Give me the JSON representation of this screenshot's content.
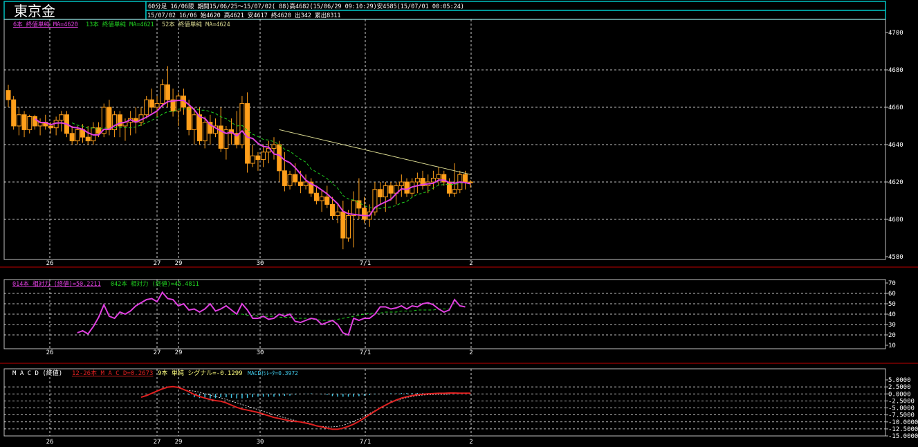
{
  "header": {
    "title": "東京金",
    "period_line": "60分足 16/06限  期間15/06/25～15/07/02( 88)高4682(15/06/29 09:10:29)安4585(15/07/01 00:05:24)",
    "ohlc_line": "15/07/02 16/06 始4620 高4621 安4617 終4620 出342 累出8311"
  },
  "legends": {
    "ma6": "6本 終値単純 MA=4620",
    "ma13": "13本 終値単純 MA=4621",
    "ma52": "52本 終値単純 MA=4624",
    "rsi14": "014本 相対力 (終値)=50.2211",
    "rsi42": "042本 相対力 (終値)=45.4811",
    "macd_title": "M A C D (終値)",
    "macd": "12-26本 M A C D=0.2673",
    "signal": "9本 単純 シグナル=-0.1299",
    "osc": "MACDｵｼﾚｰﾀ=0.3972"
  },
  "colors": {
    "bg": "#000000",
    "frame": "#c0c0c0",
    "header_border": "#00c0c0",
    "candle": "#ff9f1a",
    "ma6": "#e040e0",
    "ma13": "#20d020",
    "ma52": "#d8d890",
    "rsi14": "#e040e0",
    "rsi42": "#20d020",
    "macd": "#e02020",
    "signal": "#ffffff",
    "osc": "#40c8e8",
    "separator": "#c00000",
    "grid": "#ffffff"
  },
  "chart_data": [
    {
      "type": "candlestick",
      "panel": "price",
      "ylim": [
        4580,
        4700
      ],
      "yticks": [
        4580,
        4600,
        4620,
        4640,
        4660,
        4680,
        4700
      ],
      "x_labels": [
        "26",
        "27",
        "29",
        "30",
        "7/1",
        "2"
      ],
      "bars": [
        [
          4669,
          4672,
          4660,
          4664
        ],
        [
          4664,
          4666,
          4648,
          4650
        ],
        [
          4650,
          4660,
          4645,
          4656
        ],
        [
          4656,
          4658,
          4644,
          4648
        ],
        [
          4648,
          4656,
          4646,
          4655
        ],
        [
          4655,
          4656,
          4648,
          4650
        ],
        [
          4650,
          4654,
          4645,
          4652
        ],
        [
          4652,
          4656,
          4648,
          4650
        ],
        [
          4650,
          4652,
          4646,
          4649
        ],
        [
          4649,
          4655,
          4645,
          4653
        ],
        [
          4653,
          4658,
          4647,
          4656
        ],
        [
          4656,
          4658,
          4644,
          4646
        ],
        [
          4646,
          4650,
          4640,
          4642
        ],
        [
          4642,
          4650,
          4640,
          4648
        ],
        [
          4648,
          4651,
          4641,
          4644
        ],
        [
          4644,
          4650,
          4640,
          4642
        ],
        [
          4642,
          4652,
          4640,
          4649
        ],
        [
          4649,
          4652,
          4644,
          4646
        ],
        [
          4646,
          4662,
          4644,
          4660
        ],
        [
          4660,
          4664,
          4645,
          4648
        ],
        [
          4648,
          4658,
          4644,
          4656
        ],
        [
          4656,
          4658,
          4644,
          4650
        ],
        [
          4650,
          4654,
          4642,
          4652
        ],
        [
          4652,
          4658,
          4645,
          4654
        ],
        [
          4654,
          4660,
          4646,
          4652
        ],
        [
          4652,
          4660,
          4650,
          4656
        ],
        [
          4656,
          4666,
          4654,
          4664
        ],
        [
          4664,
          4670,
          4657,
          4660
        ],
        [
          4660,
          4666,
          4655,
          4662
        ],
        [
          4662,
          4675,
          4660,
          4672
        ],
        [
          4672,
          4682,
          4660,
          4664
        ],
        [
          4664,
          4670,
          4655,
          4658
        ],
        [
          4658,
          4668,
          4650,
          4666
        ],
        [
          4666,
          4670,
          4656,
          4660
        ],
        [
          4660,
          4664,
          4645,
          4648
        ],
        [
          4648,
          4660,
          4640,
          4656
        ],
        [
          4656,
          4660,
          4640,
          4642
        ],
        [
          4642,
          4655,
          4638,
          4652
        ],
        [
          4652,
          4656,
          4640,
          4646
        ],
        [
          4646,
          4654,
          4644,
          4650
        ],
        [
          4650,
          4660,
          4636,
          4638
        ],
        [
          4638,
          4650,
          4632,
          4648
        ],
        [
          4648,
          4654,
          4640,
          4646
        ],
        [
          4646,
          4658,
          4638,
          4640
        ],
        [
          4640,
          4666,
          4638,
          4662
        ],
        [
          4662,
          4668,
          4625,
          4630
        ],
        [
          4630,
          4640,
          4628,
          4634
        ],
        [
          4634,
          4636,
          4626,
          4632
        ],
        [
          4632,
          4640,
          4628,
          4636
        ],
        [
          4636,
          4642,
          4630,
          4638
        ],
        [
          4638,
          4644,
          4632,
          4640
        ],
        [
          4640,
          4642,
          4620,
          4626
        ],
        [
          4626,
          4636,
          4615,
          4618
        ],
        [
          4618,
          4626,
          4616,
          4624
        ],
        [
          4624,
          4630,
          4618,
          4620
        ],
        [
          4620,
          4626,
          4614,
          4618
        ],
        [
          4618,
          4624,
          4616,
          4620
        ],
        [
          4620,
          4622,
          4612,
          4614
        ],
        [
          4614,
          4618,
          4608,
          4610
        ],
        [
          4610,
          4616,
          4604,
          4612
        ],
        [
          4612,
          4618,
          4606,
          4608
        ],
        [
          4608,
          4612,
          4600,
          4602
        ],
        [
          4602,
          4608,
          4598,
          4604
        ],
        [
          4604,
          4610,
          4584,
          4590
        ],
        [
          4590,
          4605,
          4588,
          4602
        ],
        [
          4602,
          4615,
          4585,
          4610
        ],
        [
          4610,
          4622,
          4600,
          4606
        ],
        [
          4606,
          4612,
          4598,
          4600
        ],
        [
          4600,
          4608,
          4596,
          4604
        ],
        [
          4604,
          4620,
          4602,
          4616
        ],
        [
          4616,
          4620,
          4608,
          4612
        ],
        [
          4612,
          4620,
          4604,
          4618
        ],
        [
          4618,
          4620,
          4610,
          4614
        ],
        [
          4614,
          4620,
          4608,
          4618
        ],
        [
          4618,
          4624,
          4612,
          4620
        ],
        [
          4620,
          4622,
          4612,
          4614
        ],
        [
          4614,
          4622,
          4612,
          4620
        ],
        [
          4620,
          4625,
          4614,
          4622
        ],
        [
          4622,
          4626,
          4616,
          4618
        ],
        [
          4618,
          4624,
          4614,
          4620
        ],
        [
          4620,
          4626,
          4616,
          4622
        ],
        [
          4622,
          4628,
          4618,
          4624
        ],
        [
          4624,
          4626,
          4618,
          4620
        ],
        [
          4620,
          4622,
          4612,
          4614
        ],
        [
          4614,
          4630,
          4612,
          4616
        ],
        [
          4616,
          4626,
          4614,
          4624
        ],
        [
          4624,
          4626,
          4616,
          4620
        ],
        [
          4620,
          4621,
          4617,
          4620
        ]
      ],
      "ma52_start_index": 51
    },
    {
      "type": "line",
      "panel": "rsi",
      "ylim": [
        10,
        70
      ],
      "yticks": [
        10,
        20,
        30,
        40,
        50,
        60,
        70
      ],
      "rsi14": [
        null,
        null,
        null,
        null,
        null,
        null,
        null,
        null,
        null,
        null,
        null,
        null,
        null,
        22,
        24,
        21,
        28,
        37,
        49,
        38,
        36,
        42,
        40,
        43,
        48,
        51,
        54,
        55,
        52,
        61,
        55,
        54,
        48,
        50,
        44,
        45,
        42,
        45,
        50,
        43,
        45,
        48,
        44,
        40,
        50,
        44,
        36,
        36,
        38,
        35,
        36,
        40,
        38,
        40,
        33,
        32,
        34,
        36,
        35,
        30,
        32,
        34,
        30,
        22,
        20,
        36,
        34,
        36,
        36,
        40,
        47,
        47,
        45,
        46,
        48,
        45,
        48,
        47,
        50,
        51,
        49,
        45,
        42,
        44,
        54,
        48,
        47
      ],
      "rsi42": [
        null,
        null,
        null,
        null,
        null,
        null,
        null,
        null,
        null,
        null,
        null,
        null,
        null,
        null,
        null,
        null,
        null,
        null,
        null,
        null,
        null,
        null,
        null,
        null,
        null,
        null,
        null,
        null,
        null,
        null,
        null,
        null,
        null,
        null,
        null,
        null,
        null,
        null,
        null,
        null,
        null,
        null,
        40,
        40,
        40,
        39,
        39,
        38,
        38,
        38,
        38,
        37,
        37,
        37,
        36,
        36,
        36,
        35,
        35,
        34,
        34,
        34,
        35,
        36,
        37,
        38,
        39,
        40,
        41,
        41,
        41,
        42,
        42,
        42,
        43,
        43,
        43,
        44,
        44,
        44,
        44,
        45,
        45,
        45
      ]
    },
    {
      "type": "line",
      "panel": "macd",
      "ylim": [
        -15,
        5
      ],
      "yticks": [
        -15,
        -12.5,
        -10,
        -7.5,
        -5,
        -2.5,
        0,
        2.5,
        5
      ],
      "ytick_labels": [
        "-15.0000",
        "-12.5000",
        "-10.0000",
        "-7.5000",
        "-5.0000",
        "-2.5000",
        "0.0000",
        "2.5000",
        "5.0000"
      ],
      "macd": [
        null,
        null,
        null,
        null,
        null,
        null,
        null,
        null,
        null,
        null,
        null,
        null,
        null,
        null,
        null,
        null,
        null,
        null,
        null,
        null,
        null,
        null,
        null,
        null,
        null,
        -1.2,
        -0.6,
        0.2,
        1.0,
        1.8,
        2.4,
        2.6,
        2.3,
        1.6,
        0.8,
        -0.2,
        -0.9,
        -1.5,
        -2.0,
        -2.4,
        -2.6,
        -3.2,
        -4.0,
        -4.8,
        -5.4,
        -5.8,
        -6.2,
        -6.6,
        -7.2,
        -7.8,
        -8.4,
        -8.8,
        -9.2,
        -9.6,
        -9.8,
        -10.0,
        -10.4,
        -10.8,
        -11.4,
        -11.8,
        -12.2,
        -12.6,
        -12.6,
        -12.2,
        -11.6,
        -10.8,
        -9.8,
        -8.6,
        -7.4,
        -6.2,
        -5.0,
        -4.0,
        -3.0,
        -2.2,
        -1.5,
        -1.0,
        -0.6,
        -0.3,
        -0.1,
        0.0,
        0.1,
        0.2,
        0.2,
        0.3,
        0.3,
        0.27,
        0.27,
        0.2673
      ],
      "signal": [
        null,
        null,
        null,
        null,
        null,
        null,
        null,
        null,
        null,
        null,
        null,
        null,
        null,
        null,
        null,
        null,
        null,
        null,
        null,
        null,
        null,
        null,
        null,
        null,
        null,
        null,
        null,
        null,
        null,
        null,
        null,
        null,
        null,
        1.4,
        1.2,
        1.0,
        0.6,
        0.1,
        -0.4,
        -0.9,
        -1.4,
        -2.0,
        -2.6,
        -3.2,
        -3.8,
        -4.4,
        -5.0,
        -5.6,
        -6.2,
        -6.8,
        -7.4,
        -8.0,
        -8.5,
        -9.0,
        -9.5,
        -10.0,
        -10.5,
        -11.0,
        -11.4,
        -11.6,
        -11.8,
        -11.8,
        -11.6,
        -11.2,
        -10.6,
        -9.8,
        -9.0,
        -8.0,
        -7.0,
        -6.0,
        -5.0,
        -4.0,
        -3.2,
        -2.4,
        -1.8,
        -1.3,
        -0.9,
        -0.6,
        -0.4,
        -0.3,
        -0.2,
        -0.15,
        -0.13,
        -0.13
      ]
    }
  ]
}
